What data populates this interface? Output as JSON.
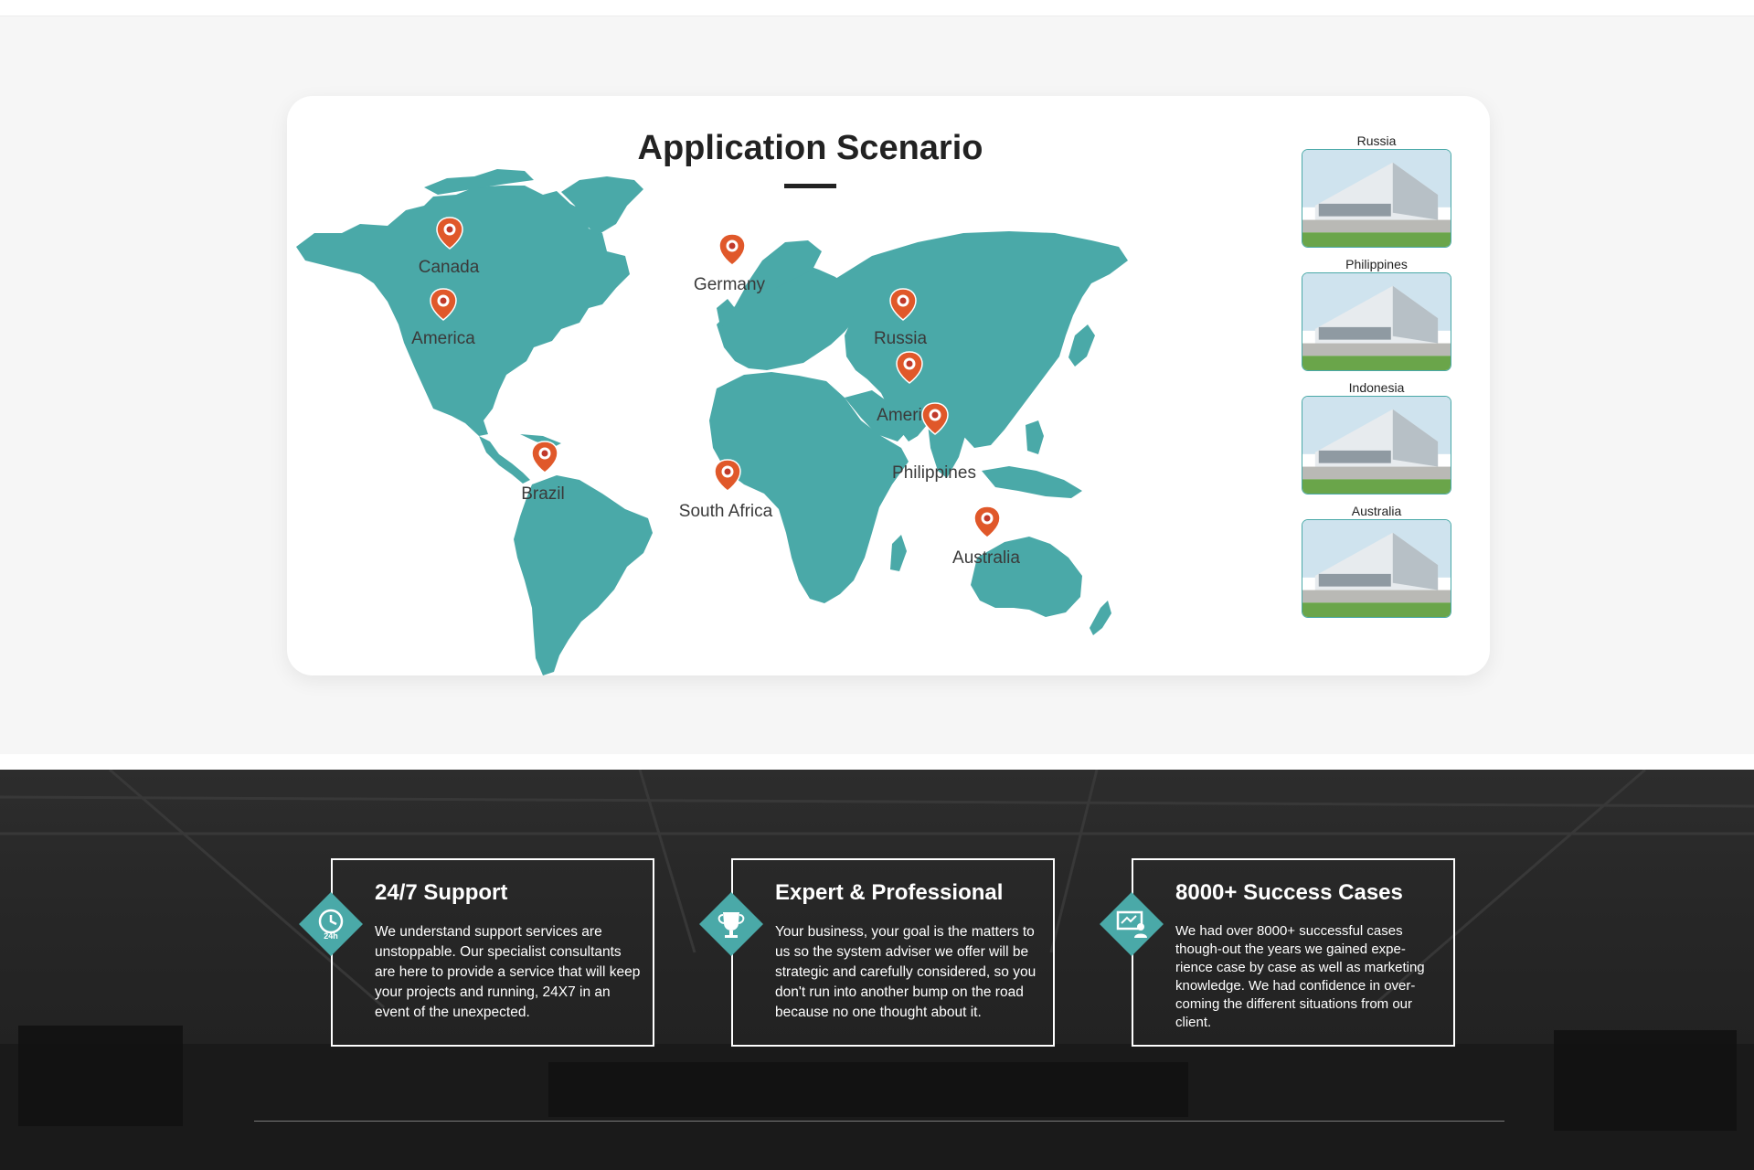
{
  "scenario": {
    "title": "Application Scenario",
    "map_color": "#4aa9a8",
    "pin_color": "#e0582a",
    "pins": [
      {
        "label": "Canada"
      },
      {
        "label": "America"
      },
      {
        "label": "Germany"
      },
      {
        "label": "Russia"
      },
      {
        "label": "America"
      },
      {
        "label": "Philippines"
      },
      {
        "label": "Brazil"
      },
      {
        "label": "South Africa"
      },
      {
        "label": "Australia"
      }
    ],
    "thumbnails": [
      {
        "label": "Russia",
        "image": "factory-building-photo"
      },
      {
        "label": "Philippines",
        "image": "factory-building-photo"
      },
      {
        "label": "Indonesia",
        "image": "factory-building-photo"
      },
      {
        "label": "Australia",
        "image": "factory-building-photo"
      }
    ]
  },
  "features": [
    {
      "icon": "24h-clock-icon",
      "title": "24/7 Support",
      "text": "We understand support services are unstoppable. Our specialist consultants are here to provide a service that will keep your projects and running, 24X7 in an event of the unexpected."
    },
    {
      "icon": "trophy-icon",
      "title": "Expert & Professional",
      "text": "Your business, your goal is the matters to us so the system adviser we offer will be strategic and carefully considered, so you don't run into another bump on the road because no one thought about it."
    },
    {
      "icon": "presenter-icon",
      "title": "8000+ Success Cases",
      "text": "We had over 8000+ successful cases though-out the years we gained expe- rience case by case as well as marketing knowledge. We had confidence in over- coming the different situations from our client."
    }
  ],
  "accent_color": "#4aa9a8"
}
